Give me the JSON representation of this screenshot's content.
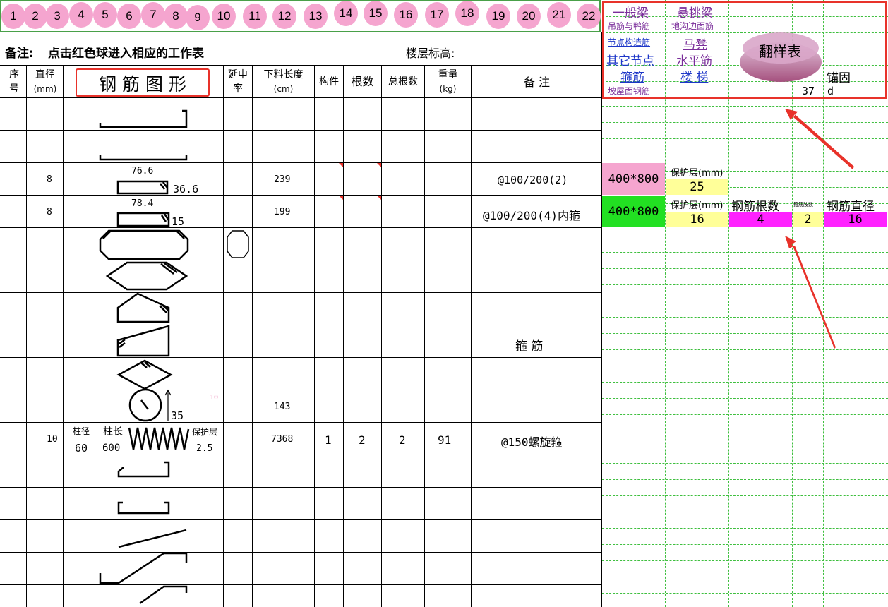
{
  "balls": [
    "1",
    "2",
    "3",
    "4",
    "5",
    "6",
    "7",
    "8",
    "9",
    "10",
    "11",
    "12",
    "13",
    "14",
    "15",
    "16",
    "17",
    "18",
    "19",
    "20",
    "21",
    "22"
  ],
  "remark": {
    "label": "备注:",
    "text": "点击红色球进入相应的工作表",
    "floor_label": "楼层标高:"
  },
  "headers": {
    "seq": [
      "序",
      "号"
    ],
    "diameter": [
      "直径",
      "(mm)"
    ],
    "shape": "钢 筋 图 形",
    "elongation": [
      "延申",
      "率"
    ],
    "cut_length": [
      "下料长度",
      "(cm)"
    ],
    "member": "构件",
    "count": "根数",
    "total_count": "总根数",
    "weight": [
      "重量",
      "(kg)"
    ],
    "note": "备    注"
  },
  "nav": {
    "general_beam": "一般梁",
    "cantilever_beam": "悬挑梁",
    "hanger_bar": "吊筋与鸭筋",
    "trench_bar": "地沟边面筋",
    "joint_bar": "节点构造筋",
    "chair_bar": "马凳",
    "other_joint": "其它节点",
    "horizontal_bar": "水平筋",
    "stirrup": "箍筋",
    "stairs": "楼 梯",
    "slope_roof": "坡屋面钢筋",
    "sample_table": "翻样表",
    "anchor_label": "锚固",
    "anchor_value": "37",
    "anchor_unit": "d"
  },
  "rows": {
    "r3": {
      "diameter": "8",
      "dim_top": "76.6",
      "dim_side": "36.6",
      "length": "239",
      "note": "@100/200(2)"
    },
    "r4": {
      "diameter": "8",
      "dim_top": "78.4",
      "dim_side": "15",
      "length": "199",
      "note": "@100/200(4)内箍"
    },
    "r9": {
      "note": "箍    筋"
    },
    "r10": {
      "dim_side": "35",
      "small": "10",
      "length": "143"
    },
    "r11": {
      "diameter": "10",
      "col_d_label": "柱径",
      "col_d": "60",
      "col_l_label": "柱长",
      "col_l": "600",
      "cover_label": "保护层",
      "cover": "2.5",
      "length": "7368",
      "member": "1",
      "count": "2",
      "total": "2",
      "weight": "91",
      "note": "@150螺旋箍"
    }
  },
  "right": {
    "beam1": {
      "size": "400*800",
      "cover_label": "保护层(mm)",
      "cover": "25"
    },
    "beam2": {
      "size": "400*800",
      "cover_label": "保护层(mm)",
      "cover": "16",
      "bar_count_label": "钢筋根数",
      "bar_count": "4",
      "tiny_label": "箍筋肢数",
      "tiny_value": "2",
      "bar_dia_label": "钢筋直径",
      "bar_dia": "16"
    }
  },
  "colors": {
    "ball": "#f5a5cf",
    "red_border": "#e8322a",
    "pink_cell": "#f5a5cf",
    "green_cell": "#22e022",
    "yellow_cell": "#ffff99",
    "magenta_cell": "#ff22ff",
    "grid_green": "#3fbf3f"
  }
}
